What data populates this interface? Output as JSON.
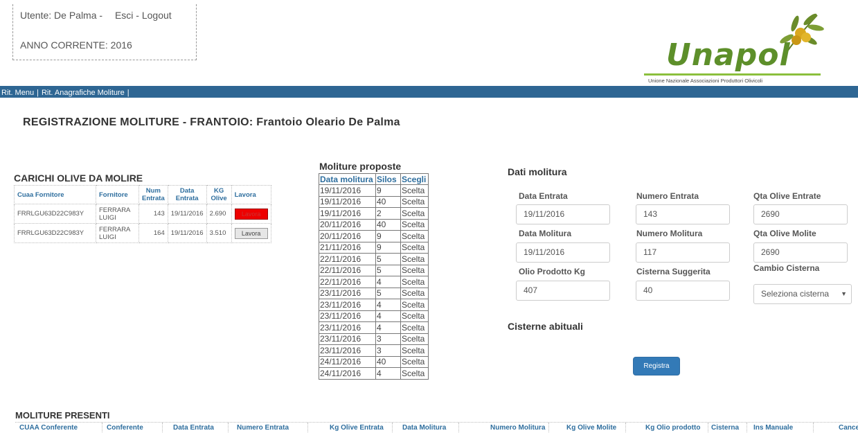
{
  "header": {
    "user_label": "Utente: De Palma -",
    "logout_label": "Esci - Logout",
    "year_label": "ANNO CORRENTE: 2016",
    "logo_word": "Unapol",
    "logo_subtitle": "Unione Nazionale Associazioni Produttori Olivicoli"
  },
  "nav": {
    "menu_label": "Rit. Menu",
    "sep1": "|",
    "anagrafiche_label": "Rit. Anagrafiche Moliture",
    "sep2": "|"
  },
  "page_title": "REGISTRAZIONE MOLITURE - FRANTOIO: Frantoio Oleario De Palma",
  "carichi": {
    "title": "CARICHI OLIVE DA MOLIRE",
    "headers": [
      "Cuaa Fornitore",
      "Fornitore",
      "Num Entrata",
      "Data Entrata",
      "KG Olive",
      "Lavora"
    ],
    "rows": [
      {
        "cuaa": "FRRLGU63D22C983Y",
        "fornitore": "FERRARA LUIGI",
        "num": "143",
        "data": "19/11/2016",
        "kg": "2.690",
        "btn": "Lavora"
      },
      {
        "cuaa": "FRRLGU63D22C983Y",
        "fornitore": "FERRARA LUIGI",
        "num": "164",
        "data": "19/11/2016",
        "kg": "3.510",
        "btn": "Lavora"
      }
    ]
  },
  "proposte": {
    "title": "Moliture proposte",
    "headers": [
      "Data molitura",
      "Silos",
      "Scegli"
    ],
    "rows": [
      [
        "19/11/2016",
        "9",
        "Scelta"
      ],
      [
        "19/11/2016",
        "40",
        "Scelta"
      ],
      [
        "19/11/2016",
        "2",
        "Scelta"
      ],
      [
        "20/11/2016",
        "40",
        "Scelta"
      ],
      [
        "20/11/2016",
        "9",
        "Scelta"
      ],
      [
        "21/11/2016",
        "9",
        "Scelta"
      ],
      [
        "22/11/2016",
        "5",
        "Scelta"
      ],
      [
        "22/11/2016",
        "5",
        "Scelta"
      ],
      [
        "22/11/2016",
        "4",
        "Scelta"
      ],
      [
        "23/11/2016",
        "5",
        "Scelta"
      ],
      [
        "23/11/2016",
        "4",
        "Scelta"
      ],
      [
        "23/11/2016",
        "4",
        "Scelta"
      ],
      [
        "23/11/2016",
        "4",
        "Scelta"
      ],
      [
        "23/11/2016",
        "3",
        "Scelta"
      ],
      [
        "23/11/2016",
        "3",
        "Scelta"
      ],
      [
        "24/11/2016",
        "40",
        "Scelta"
      ],
      [
        "24/11/2016",
        "4",
        "Scelta"
      ]
    ]
  },
  "dati": {
    "title": "Dati molitura",
    "data_entrata_label": "Data Entrata",
    "data_entrata_value": "19/11/2016",
    "numero_entrata_label": "Numero Entrata",
    "numero_entrata_value": "143",
    "qta_entrate_label": "Qta Olive Entrate",
    "qta_entrate_value": "2690",
    "data_molitura_label": "Data Molitura",
    "data_molitura_value": "19/11/2016",
    "numero_molitura_label": "Numero Molitura",
    "numero_molitura_value": "117",
    "qta_molite_label": "Qta Olive Molite",
    "qta_molite_value": "2690",
    "olio_label": "Olio Prodotto Kg",
    "olio_value": "407",
    "cisterna_sugg_label": "Cisterna Suggerita",
    "cisterna_sugg_value": "40",
    "cambio_label": "Cambio Cisterna",
    "cambio_select": "Seleziona cisterna",
    "cisterne_abituali_title": "Cisterne abituali",
    "registra_label": "Registra"
  },
  "moliture_presenti": {
    "title": "MOLITURE PRESENTI",
    "headers": [
      "CUAA Conferente",
      "Conferente",
      "Data Entrata",
      "Numero Entrata",
      "Kg Olive Entrata",
      "Data Molitura",
      "Numero Molitura",
      "Kg Olive Molite",
      "Kg Olio prodotto",
      "Cisterna",
      "Ins Manuale",
      "Cance"
    ]
  },
  "colors": {
    "nav_bg": "#2e6693",
    "header_blue": "#2e6e9e",
    "button_red": "#ee0000",
    "registra_blue": "#337ab7",
    "logo_green": "#5d8f2a"
  }
}
